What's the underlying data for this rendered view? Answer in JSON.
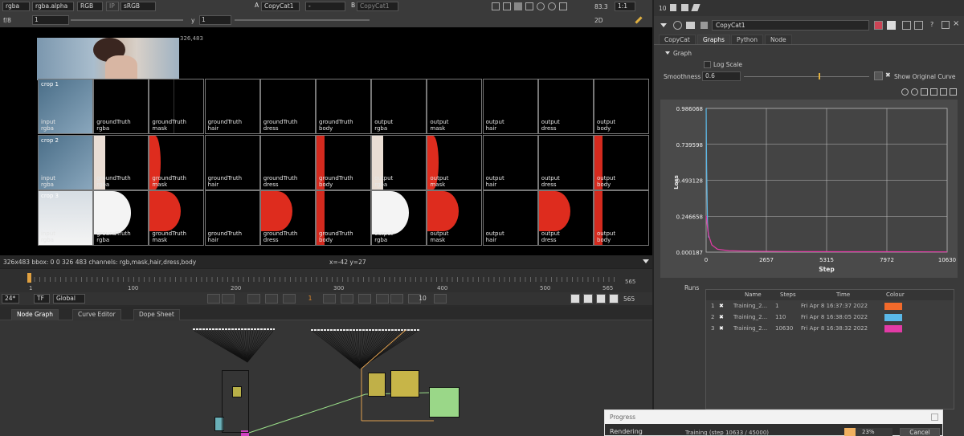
{
  "viewer": {
    "channels": "rgba",
    "channel_alpha": "rgba.alpha",
    "colorspace_mode": "RGB",
    "ip": "IP",
    "lut": "sRGB",
    "input_a_letter": "A",
    "input_a": "CopyCat1",
    "dash": "-",
    "input_b_letter": "B",
    "input_b": "CopyCat1",
    "zoom_pct": "83.3",
    "ratio": "1:1",
    "fstop": "f/8",
    "frame": "1",
    "y_label": "y",
    "y_val": "1",
    "view_mode": "2D",
    "image_size_label": "326,483",
    "status": "326x483  bbox: 0 0 326 483 channels: rgb,mask,hair,dress,body",
    "coords": "x=-42 y=27"
  },
  "grid": {
    "crops": [
      "crop 1",
      "crop 2",
      "crop 3"
    ],
    "columns": [
      [
        "input",
        "rgba"
      ],
      [
        "groundTruth",
        "rgba"
      ],
      [
        "groundTruth",
        "mask"
      ],
      [
        "groundTruth",
        "hair"
      ],
      [
        "groundTruth",
        "dress"
      ],
      [
        "groundTruth",
        "body"
      ],
      [
        "output",
        "rgba"
      ],
      [
        "output",
        "mask"
      ],
      [
        "output",
        "hair"
      ],
      [
        "output",
        "dress"
      ],
      [
        "output",
        "body"
      ]
    ]
  },
  "timeline": {
    "start": "1",
    "end_right": "565",
    "ticks": [
      "100",
      "200",
      "300",
      "400",
      "500",
      "565"
    ],
    "fps": "24*",
    "tf": "TF",
    "scope": "Global",
    "current_frame": "1",
    "step": "10",
    "end_frame": "565"
  },
  "lower_tabs": [
    "Node Graph",
    "Curve Editor",
    "Dope Sheet"
  ],
  "properties": {
    "count": "10",
    "node_name": "CopyCat1",
    "tabs": [
      "CopyCat",
      "Graphs",
      "Python",
      "Node"
    ],
    "active_tab": "Graphs",
    "section": "Graph",
    "log_scale": "Log Scale",
    "smoothness_label": "Smoothness",
    "smoothness_value": "0.6",
    "show_original": "Show Original Curve",
    "runs_label": "Runs",
    "runs_headers": [
      "Name",
      "Steps",
      "Time",
      "Colour"
    ],
    "runs": [
      {
        "idx": "1",
        "name": "Training_2...",
        "steps": "1",
        "time": "Fri Apr  8 16:37:37 2022",
        "color": "#f26a2b"
      },
      {
        "idx": "2",
        "name": "Training_2...",
        "steps": "110",
        "time": "Fri Apr  8 16:38:05 2022",
        "color": "#5ab8e8"
      },
      {
        "idx": "3",
        "name": "Training_2...",
        "steps": "10630",
        "time": "Fri Apr  8 16:38:32 2022",
        "color": "#e23ba6"
      }
    ]
  },
  "chart_data": {
    "type": "line",
    "xlabel": "Step",
    "ylabel": "Loss",
    "xlim": [
      0,
      10630
    ],
    "ylim": [
      0.000187,
      0.986068
    ],
    "x_ticks": [
      "0",
      "2657",
      "5315",
      "7972",
      "10630"
    ],
    "y_ticks": [
      "0.986068",
      "0.739598",
      "0.493128",
      "0.246658",
      "0.000187"
    ],
    "grid": true,
    "series": [
      {
        "color": "#5ab8e8",
        "x": [
          0,
          1,
          20,
          60,
          110
        ],
        "y": [
          0.986,
          0.986,
          0.6,
          0.2,
          0.1
        ]
      },
      {
        "color": "#e23ba6",
        "x": [
          0,
          100,
          250,
          500,
          1000,
          2000,
          4000,
          6000,
          8000,
          10630
        ],
        "y": [
          0.25,
          0.12,
          0.05,
          0.02,
          0.01,
          0.006,
          0.004,
          0.003,
          0.003,
          0.002
        ]
      }
    ]
  },
  "progress": {
    "title": "Progress",
    "rendering": "Rendering",
    "detail": "Training (step 10633 / 45000)",
    "percent": 23,
    "percent_label": "23%",
    "cancel": "Cancel"
  }
}
